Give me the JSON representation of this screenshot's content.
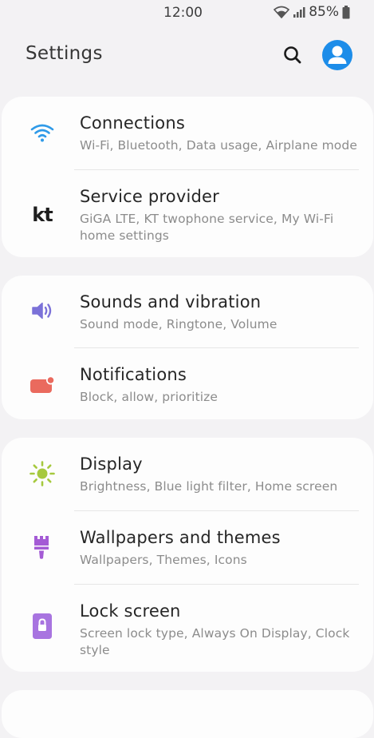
{
  "status_bar": {
    "time": "12:00",
    "battery": "85%"
  },
  "header": {
    "title": "Settings"
  },
  "icons": {
    "wifi": "wifi-icon",
    "service": "kt-logo-icon",
    "sound": "speaker-icon",
    "notifications": "notification-icon",
    "display": "sun-icon",
    "wallpaper": "paintbrush-icon",
    "lock": "lock-icon"
  },
  "colors": {
    "wifi": "#2f9ae8",
    "sound": "#7b71d8",
    "notifications": "#ea6a5e",
    "display": "#a6c93e",
    "wallpaper": "#a45bd5",
    "lock": "#a874e0",
    "avatar": "#1d8de9"
  },
  "service_logo_text": "kt",
  "groups": [
    {
      "items": [
        {
          "title": "Connections",
          "subtitle": "Wi-Fi, Bluetooth, Data usage, Airplane mode"
        },
        {
          "title": "Service provider",
          "subtitle": "GiGA LTE, KT twophone service, My Wi-Fi home settings"
        }
      ]
    },
    {
      "items": [
        {
          "title": "Sounds and vibration",
          "subtitle": "Sound mode, Ringtone, Volume"
        },
        {
          "title": "Notifications",
          "subtitle": "Block, allow, prioritize"
        }
      ]
    },
    {
      "items": [
        {
          "title": "Display",
          "subtitle": "Brightness, Blue light filter, Home screen"
        },
        {
          "title": "Wallpapers and themes",
          "subtitle": "Wallpapers, Themes, Icons"
        },
        {
          "title": "Lock screen",
          "subtitle": "Screen lock type, Always On Display, Clock style"
        }
      ]
    }
  ]
}
